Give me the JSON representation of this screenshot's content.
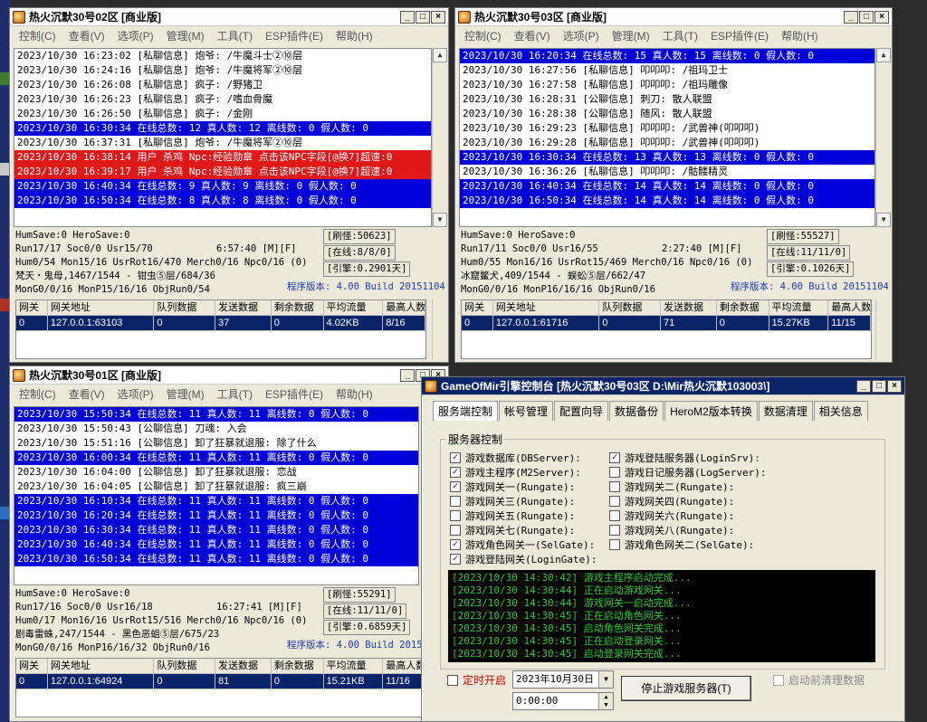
{
  "menu": [
    "控制(C)",
    "查看(V)",
    "选项(P)",
    "管理(M)",
    "工具(T)",
    "ESP插件(E)",
    "帮助(H)"
  ],
  "win_controls": {
    "min": "_",
    "max": "□",
    "close": "×"
  },
  "grid_headers": [
    "网关",
    "网关地址",
    "队列数据",
    "发送数据",
    "剩余数据",
    "平均流量",
    "最高人数"
  ],
  "win02": {
    "title": "热火沉默30号02区 [商业版]",
    "log": [
      {
        "t": "2023/10/30 16:23:02 [私聊信息] 炮爷: /牛魔斗士②⑩层",
        "c": ""
      },
      {
        "t": "2023/10/30 16:24:16 [私聊信息] 炮爷: /牛魔将军②⑩层",
        "c": ""
      },
      {
        "t": "2023/10/30 16:26:08 [私聊信息] 疯子: /野猪卫",
        "c": ""
      },
      {
        "t": "2023/10/30 16:26:23 [私聊信息] 疯子: /嗜血骨魔",
        "c": ""
      },
      {
        "t": "2023/10/30 16:26:50 [私聊信息] 疯子: /金刚",
        "c": ""
      },
      {
        "t": "2023/10/30 16:30:34 在线总数: 12 真人数: 12 离线数: 0 假人数: 0",
        "c": "blue"
      },
      {
        "t": "2023/10/30 16:37:31 [私聊信息] 炮爷: /牛魔将军②⑩层",
        "c": ""
      },
      {
        "t": "2023/10/30 16:38:14 用户 杀鸡 Npc:经验勋章 点击该NPC字段[@换7]超速:0",
        "c": "red"
      },
      {
        "t": "2023/10/30 16:39:17 用户 杀鸡 Npc:经验勋章 点击该NPC字段[@换7]超速:0",
        "c": "red"
      },
      {
        "t": "2023/10/30 16:40:34 在线总数: 9 真人数: 9 离线数: 0 假人数: 0",
        "c": "blue"
      },
      {
        "t": "2023/10/30 16:50:34 在线总数: 8 真人数: 8 离线数: 0 假人数: 0",
        "c": "blue"
      }
    ],
    "stats": {
      "l1": "HumSave:0 HeroSave:0",
      "l2": "Run17/17 Soc0/0 Usr15/70",
      "l2t": "6:57:40 [M][F]",
      "l3": "Hum0/54 Mon15/16 UsrRot16/470 Merch0/16 Npc0/16 (0)",
      "l4": "梵天・鬼母,1467/1544 - 钳虫⑤层/684/36",
      "l5": "MonG0/0/16 MonP15/16/16 ObjRun0/54",
      "refresh": "[刷怪:50623]",
      "online": "[在线:8/8/0]",
      "engine": "[引擎:0.2901天]",
      "version": "程序版本: 4.00 Build 20151104"
    },
    "grid": [
      [
        "0",
        "127.0.0.1:63103",
        "0",
        "37",
        "0",
        "4.02KB",
        "8/16"
      ]
    ]
  },
  "win03": {
    "title": "热火沉默30号03区 [商业版]",
    "log": [
      {
        "t": "2023/10/30 16:20:34 在线总数: 15 真人数: 15 离线数: 0 假人数: 0",
        "c": "blue"
      },
      {
        "t": "2023/10/30 16:27:56 [私聊信息] 叩叩叩: /祖玛卫士",
        "c": ""
      },
      {
        "t": "2023/10/30 16:27:58 [私聊信息] 叩叩叩: /祖玛雕像",
        "c": ""
      },
      {
        "t": "2023/10/30 16:28:31 [公聊信息] 刺刀: 散人联盟",
        "c": ""
      },
      {
        "t": "2023/10/30 16:28:38 [公聊信息] 随风: 散人联盟",
        "c": ""
      },
      {
        "t": "2023/10/30 16:29:23 [私聊信息] 叩叩叩: /武兽神(叩叩叩)",
        "c": ""
      },
      {
        "t": "2023/10/30 16:29:28 [私聊信息] 叩叩叩: /武兽神(叩叩叩)",
        "c": ""
      },
      {
        "t": "2023/10/30 16:30:34 在线总数: 13 真人数: 13 离线数: 0 假人数: 0",
        "c": "blue"
      },
      {
        "t": "2023/10/30 16:36:26 [私聊信息] 叩叩叩: /骷髅精灵",
        "c": ""
      },
      {
        "t": "2023/10/30 16:40:34 在线总数: 14 真人数: 14 离线数: 0 假人数: 0",
        "c": "blue"
      },
      {
        "t": "2023/10/30 16:50:34 在线总数: 14 真人数: 14 离线数: 0 假人数: 0",
        "c": "blue"
      }
    ],
    "stats": {
      "l1": "HumSave:0 HeroSave:0",
      "l2": "Run17/11 Soc0/0 Usr16/55",
      "l2t": "2:27:40 [M][F]",
      "l3": "Hum0/55 Mon16/16 UsrRot15/469 Merch0/16 Npc0/16 (0)",
      "l4": "冰窟鳖犬,409/1544 - 蜈蚣⑤层/662/47",
      "l5": "MonG0/0/16 MonP16/16/16 ObjRun0/16",
      "refresh": "[刷怪:55527]",
      "online": "[在线:11/11/0]",
      "engine": "[引擎:0.1026天]",
      "version": "程序版本: 4.00 Build 20151104"
    },
    "grid": [
      [
        "0",
        "127.0.0.1:61716",
        "0",
        "71",
        "0",
        "15.27KB",
        "11/15"
      ]
    ]
  },
  "win01": {
    "title": "热火沉默30号01区 [商业版]",
    "log": [
      {
        "t": "2023/10/30 15:50:34 在线总数: 11 真人数: 11 离线数: 0 假人数: 0",
        "c": "blue"
      },
      {
        "t": "2023/10/30 15:50:43 [公聊信息] 刀魂: 入会",
        "c": ""
      },
      {
        "t": "2023/10/30 15:51:16 [公聊信息] 卸了狂暴就退服: 除了什么",
        "c": ""
      },
      {
        "t": "2023/10/30 16:00:34 在线总数: 11 真人数: 11 离线数: 0 假人数: 0",
        "c": "blue"
      },
      {
        "t": "2023/10/30 16:04:00 [公聊信息] 卸了狂暴就退服: 恋战",
        "c": ""
      },
      {
        "t": "2023/10/30 16:04:05 [公聊信息] 卸了狂暴就退服: 疯三崩",
        "c": ""
      },
      {
        "t": "2023/10/30 16:10:34 在线总数: 11 真人数: 11 离线数: 0 假人数: 0",
        "c": "blue"
      },
      {
        "t": "2023/10/30 16:20:34 在线总数: 11 真人数: 11 离线数: 0 假人数: 0",
        "c": "blue"
      },
      {
        "t": "2023/10/30 16:30:34 在线总数: 11 真人数: 11 离线数: 0 假人数: 0",
        "c": "blue"
      },
      {
        "t": "2023/10/30 16:40:34 在线总数: 11 真人数: 11 离线数: 0 假人数: 0",
        "c": "blue"
      },
      {
        "t": "2023/10/30 16:50:34 在线总数: 11 真人数: 11 离线数: 0 假人数: 0",
        "c": "blue"
      }
    ],
    "stats": {
      "l1": "HumSave:0 HeroSave:0",
      "l2": "Run17/16 Soc0/0 Usr16/18",
      "l2t": "16:27:41 [M][F]",
      "l3": "Hum0/17 Mon16/16 UsrRot15/516 Merch0/16 Npc0/16 (0)",
      "l4": "剧毒雷蛛,247/1544 - 黑色恶蛆⑤层/675/23",
      "l5": "MonG0/0/16 MonP16/16/32 ObjRun0/16",
      "refresh": "[刷怪:55291]",
      "online": "[在线:11/11/0]",
      "engine": "[引擎:0.6859天]",
      "version": "程序版本: 4.00 Build 2015"
    },
    "grid": [
      [
        "0",
        "127.0.0.1:64924",
        "0",
        "81",
        "0",
        "15.21KB",
        "11/16"
      ]
    ]
  },
  "ctrl": {
    "title": "GameOfMir引擎控制台 [热火沉默30号03区 D:\\Mir热火沉默103003\\]",
    "tabs": [
      "服务端控制",
      "帐号管理",
      "配置向导",
      "数据备份",
      "HeroM2版本转换",
      "数据清理",
      "相关信息"
    ],
    "group_title": "服务器控制",
    "left_checks": [
      {
        "label": "游戏数据库(DBServer):",
        "on": true
      },
      {
        "label": "游戏主程序(M2Server):",
        "on": true
      },
      {
        "label": "游戏网关一(Rungate):",
        "on": true
      },
      {
        "label": "游戏网关三(Rungate):",
        "on": false
      },
      {
        "label": "游戏网关五(Rungate):",
        "on": false
      },
      {
        "label": "游戏网关七(Rungate):",
        "on": false
      },
      {
        "label": "游戏角色网关一(SelGate):",
        "on": true
      },
      {
        "label": "游戏登陆网关(LoginGate):",
        "on": true
      }
    ],
    "right_checks": [
      {
        "label": "游戏登陆服务器(LoginSrv):",
        "on": true
      },
      {
        "label": "游戏日记服务器(LogServer):",
        "on": false
      },
      {
        "label": "游戏网关二(Rungate):",
        "on": false
      },
      {
        "label": "游戏网关四(Rungate):",
        "on": false
      },
      {
        "label": "游戏网关六(Rungate):",
        "on": false
      },
      {
        "label": "游戏网关八(Rungate):",
        "on": false
      },
      {
        "label": "游戏角色网关二(SelGate):",
        "on": false
      }
    ],
    "console": [
      "[2023/10/30 14:30:42] 游戏主程序启动完成...",
      "[2023/10/30 14:30:44] 正在启动游戏网关...",
      "[2023/10/30 14:30:44] 游戏网关一启动完成...",
      "[2023/10/30 14:30:45] 正在启动角色网关...",
      "[2023/10/30 14:30:45] 启动角色网关完成...",
      "[2023/10/30 14:30:45] 正在启动登录网关...",
      "[2023/10/30 14:30:45] 启动登录网关完成..."
    ],
    "timer_label": "定时开启",
    "date": "2023年10月30日",
    "time": "0:00:00",
    "stop_button": "停止游戏服务器(T)",
    "clear_label": "启动前清理数据"
  },
  "colors": {
    "log_blue": "#0000d8",
    "log_red": "#e01818",
    "console_green": "#22d22a",
    "active_title": "#0a246a"
  }
}
